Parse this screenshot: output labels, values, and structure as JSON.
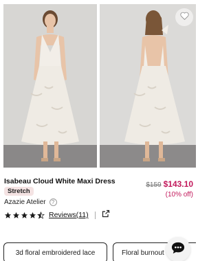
{
  "product": {
    "title": "Isabeau Cloud White Maxi Dress",
    "badge": "Stretch",
    "brand": "Azazie Atelier",
    "original_price": "$159",
    "sale_price": "$143.10",
    "discount": "(10% off)",
    "rating": 4.5,
    "reviews_label": "Reviews(11)"
  },
  "tags": [
    "3d floral embroidered lace",
    "Floral burnout"
  ],
  "icons": {
    "favorite": "heart-icon",
    "help": "question-circle-icon",
    "share": "external-link-icon",
    "chat": "chat-bubble-icon"
  },
  "colors": {
    "sale": "#c2185b",
    "badge_bg": "#f4e3e3"
  }
}
